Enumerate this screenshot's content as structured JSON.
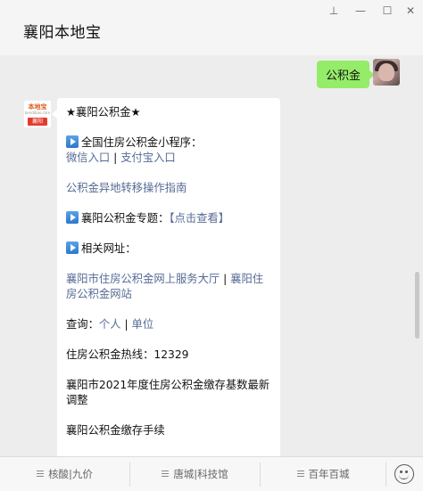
{
  "window": {
    "title": "襄阳本地宝",
    "pin_glyph": "⊥",
    "minimize_glyph": "—",
    "maximize_glyph": "☐",
    "close_glyph": "✕"
  },
  "chat": {
    "user_message": "公积金",
    "bot_avatar": {
      "top": "本地宝",
      "mid": "bendibao.com",
      "bottom": "襄阳"
    },
    "reply": {
      "heading": "★襄阳公积金★",
      "section1_title": "全国住房公积金小程序：",
      "wechat_link": "微信入口",
      "alipay_link": "支付宝入口",
      "transfer_guide_link": "公积金异地转移操作指南",
      "section2_title": "襄阳公积金专题：",
      "section2_link": "【点击查看】",
      "section3_title": "相关网址：",
      "url_link1": "襄阳市住房公积金网上服务大厅",
      "url_link2": "襄阳住房公积金网站",
      "query_label": "查询：",
      "query_personal": "个人",
      "query_unit": "单位",
      "hotline_label": "住房公积金热线：",
      "hotline_number": "12329",
      "base_adjust_text": "襄阳市2021年度住房公积金缴存基数最新调整",
      "deposit_proc_text": "襄阳公积金缴存手续"
    }
  },
  "bottom_menu": {
    "items": [
      "核酸|九价",
      "唐城|科技馆",
      "百年百城"
    ]
  },
  "colors": {
    "link": "#576b95",
    "user_bubble": "#95ec69",
    "background": "#ededed"
  }
}
